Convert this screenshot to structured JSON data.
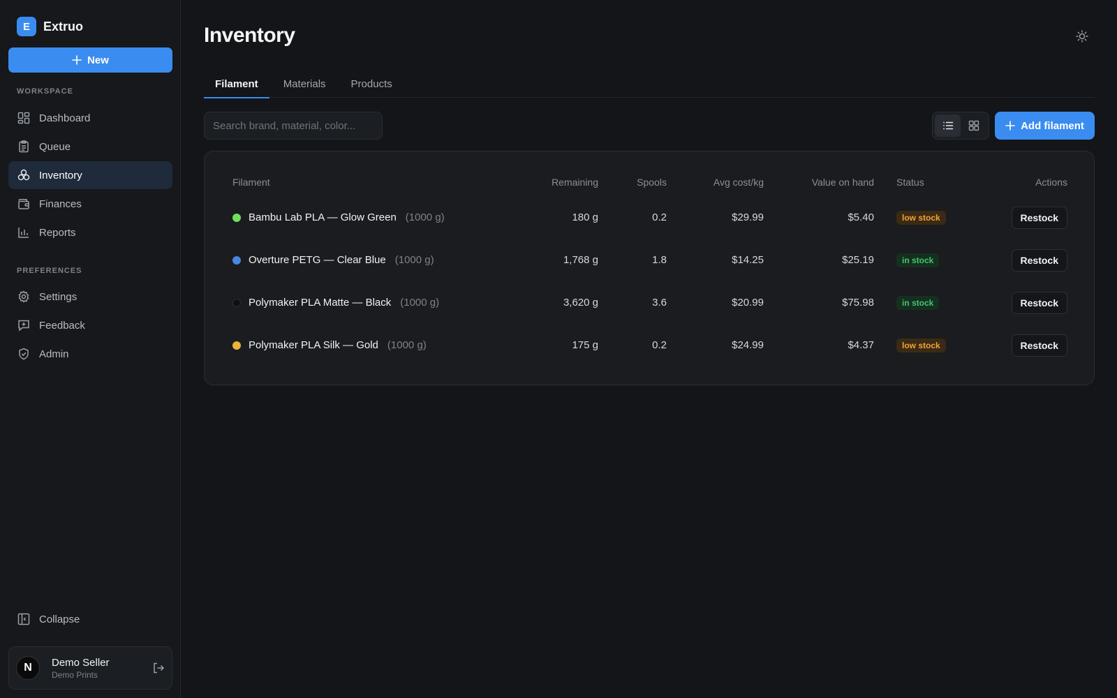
{
  "app": {
    "brand_initial": "E",
    "brand_name": "Extruo",
    "new_label": "New",
    "accent": "#3b8cf0"
  },
  "sidebar": {
    "workspace_label": "WORKSPACE",
    "workspace_items": [
      {
        "label": "Dashboard",
        "icon": "dashboard-icon"
      },
      {
        "label": "Queue",
        "icon": "clipboard-icon"
      },
      {
        "label": "Inventory",
        "icon": "filament-icon",
        "active": true
      },
      {
        "label": "Finances",
        "icon": "wallet-icon"
      },
      {
        "label": "Reports",
        "icon": "bar-chart-icon"
      }
    ],
    "preferences_label": "PREFERENCES",
    "preferences_items": [
      {
        "label": "Settings",
        "icon": "gear-icon"
      },
      {
        "label": "Feedback",
        "icon": "message-plus-icon"
      },
      {
        "label": "Admin",
        "icon": "shield-check-icon"
      }
    ],
    "collapse_label": "Collapse",
    "user": {
      "initial": "N",
      "name": "Demo Seller",
      "org": "Demo Prints"
    }
  },
  "page": {
    "title": "Inventory",
    "tabs": [
      {
        "label": "Filament",
        "active": true
      },
      {
        "label": "Materials"
      },
      {
        "label": "Products"
      }
    ],
    "search_placeholder": "Search brand, material, color...",
    "view_modes": [
      "list",
      "grid"
    ],
    "active_view": "list",
    "add_label": "Add filament"
  },
  "table": {
    "columns": [
      "Filament",
      "Remaining",
      "Spools",
      "Avg cost/kg",
      "Value on hand",
      "Status",
      "Actions"
    ],
    "rows": [
      {
        "color": "#6ee05a",
        "name": "Bambu Lab PLA — Glow Green",
        "size": "(1000 g)",
        "remaining": "180 g",
        "spools": "0.2",
        "avg_cost": "$29.99",
        "value": "$5.40",
        "status": "low stock",
        "status_kind": "low",
        "action": "Restock"
      },
      {
        "color": "#4a86e0",
        "name": "Overture PETG — Clear Blue",
        "size": "(1000 g)",
        "remaining": "1,768 g",
        "spools": "1.8",
        "avg_cost": "$14.25",
        "value": "$25.19",
        "status": "in stock",
        "status_kind": "in",
        "action": "Restock"
      },
      {
        "color": "#0f1012",
        "name": "Polymaker PLA Matte — Black",
        "size": "(1000 g)",
        "remaining": "3,620 g",
        "spools": "3.6",
        "avg_cost": "$20.99",
        "value": "$75.98",
        "status": "in stock",
        "status_kind": "in",
        "action": "Restock"
      },
      {
        "color": "#e8b43a",
        "name": "Polymaker PLA Silk — Gold",
        "size": "(1000 g)",
        "remaining": "175 g",
        "spools": "0.2",
        "avg_cost": "$24.99",
        "value": "$4.37",
        "status": "low stock",
        "status_kind": "low",
        "action": "Restock"
      }
    ]
  }
}
